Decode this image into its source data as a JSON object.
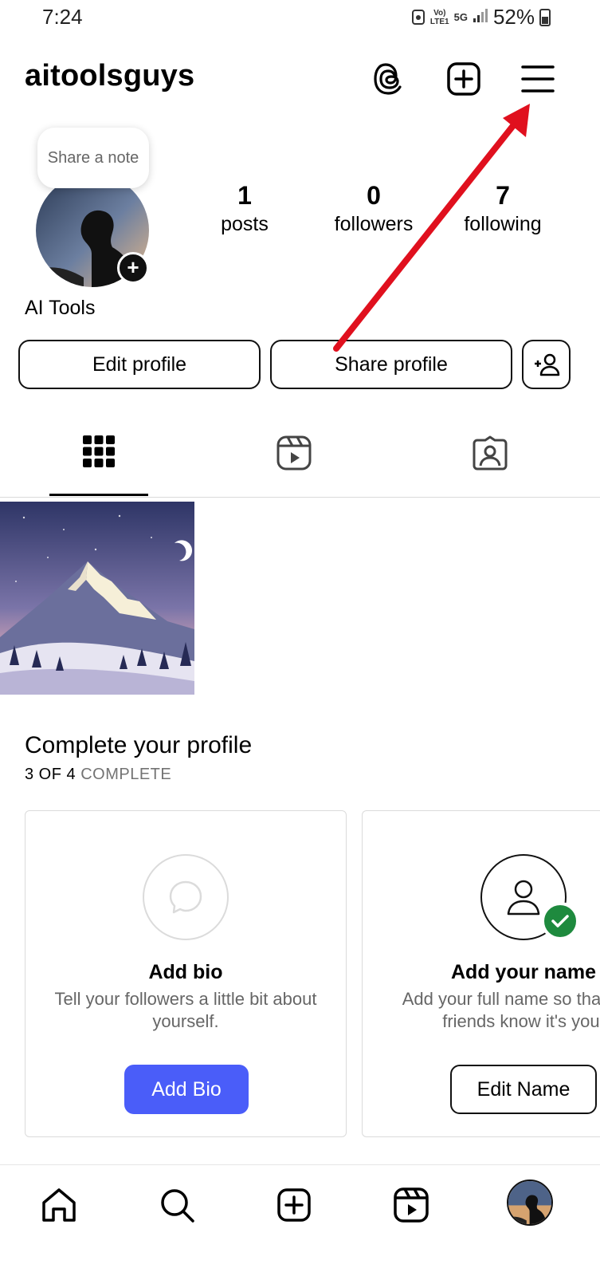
{
  "status_bar": {
    "time": "7:24",
    "network_labels": [
      "Vo)",
      "LTE1",
      "5G"
    ],
    "battery": "52%"
  },
  "header": {
    "username": "aitoolsguys",
    "icons": [
      "threads-icon",
      "create-plus-icon",
      "menu-hamburger-icon"
    ]
  },
  "profile": {
    "note_placeholder": "Share a note",
    "display_name": "AI Tools",
    "stats": {
      "posts": {
        "count": "1",
        "label": "posts"
      },
      "followers": {
        "count": "0",
        "label": "followers"
      },
      "following": {
        "count": "7",
        "label": "following"
      }
    },
    "buttons": {
      "edit": "Edit profile",
      "share": "Share profile"
    }
  },
  "tabs": [
    {
      "icon": "grid-icon",
      "active": true
    },
    {
      "icon": "reels-icon",
      "active": false
    },
    {
      "icon": "tagged-icon",
      "active": false
    }
  ],
  "complete_profile": {
    "title": "Complete your profile",
    "progress_count": "3 OF 4",
    "progress_word": "COMPLETE",
    "cards": [
      {
        "title": "Add bio",
        "description": "Tell your followers a little bit about yourself.",
        "button": "Add Bio",
        "done": false
      },
      {
        "title": "Add your name",
        "description": "Add your full name so that your friends know it's you.",
        "button": "Edit Name",
        "done": true
      }
    ]
  },
  "bottom_nav": [
    "home-icon",
    "search-icon",
    "create-icon",
    "reels-icon",
    "profile-avatar"
  ],
  "colors": {
    "primary_button": "#4a5df9",
    "annotation_arrow": "#e0101e",
    "success": "#1e8a3e"
  }
}
